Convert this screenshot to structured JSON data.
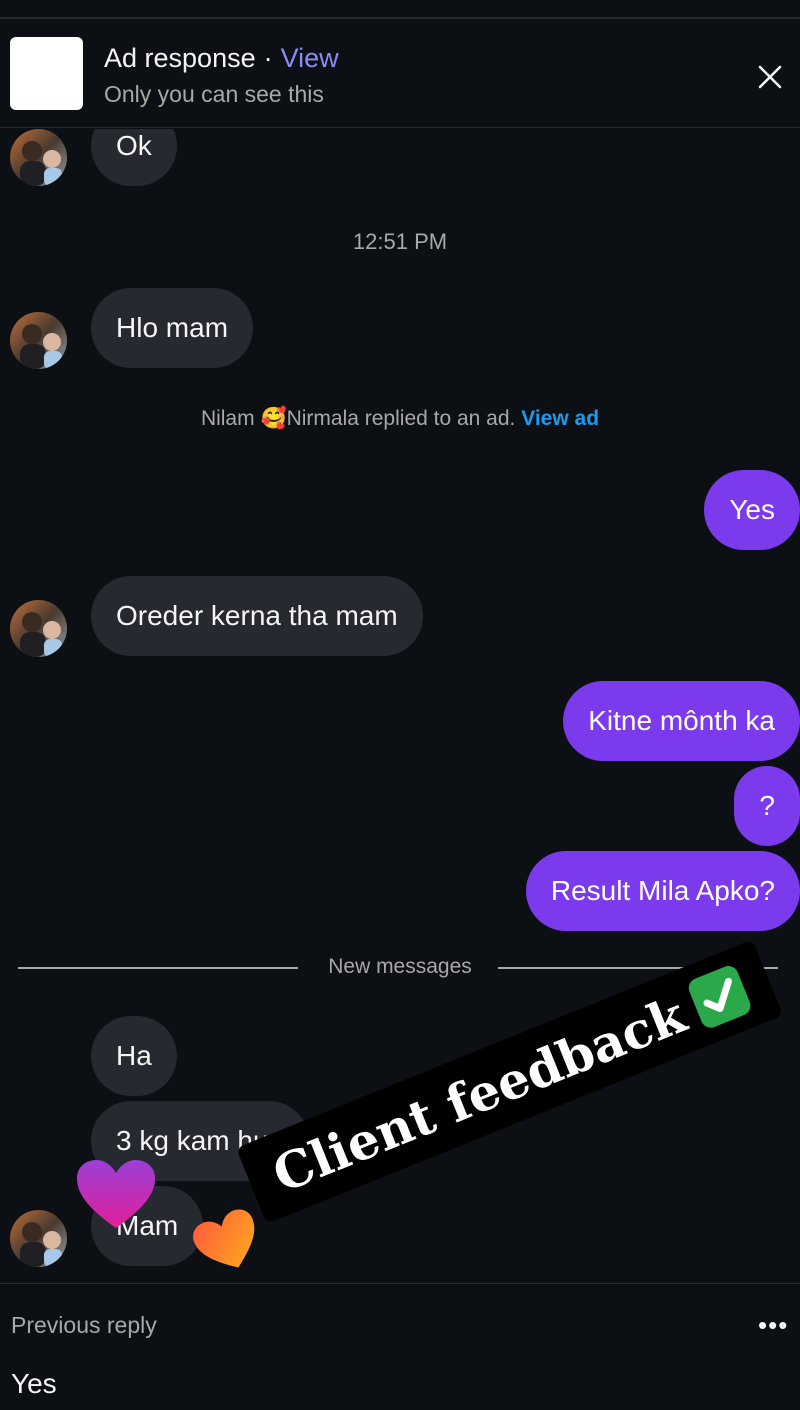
{
  "header": {
    "title": "Ad response",
    "separator": "·",
    "view_link": "View",
    "subtitle": "Only you can see this"
  },
  "messages": {
    "ok": "Ok",
    "timestamp": "12:51 PM",
    "hlo": "Hlo mam",
    "ad_note_text": "Nilam 🥰Nirmala replied to an ad.",
    "ad_note_link": "View ad",
    "yes": "Yes",
    "oreder": "Oreder kerna tha mam",
    "kitne": "Kitne mônth ka",
    "question": "?",
    "result": "Result Mila Apko?",
    "new_messages": "New messages",
    "ha": "Ha",
    "kg": "3 kg kam hua",
    "mam": "Mam"
  },
  "footer": {
    "label": "Previous reply",
    "more": "•••",
    "reply_text": "Yes"
  },
  "sticker": {
    "text": "Client feedback"
  },
  "colors": {
    "background": "#0c1014",
    "incoming_bubble": "#262a30",
    "outgoing_bubble": "#7c3aed",
    "link_blue": "#1d9bf0",
    "view_link": "#8a8cf5"
  },
  "icons": [
    "close-icon",
    "more-icon",
    "check-icon",
    "purple-heart-icon",
    "orange-heart-icon"
  ]
}
